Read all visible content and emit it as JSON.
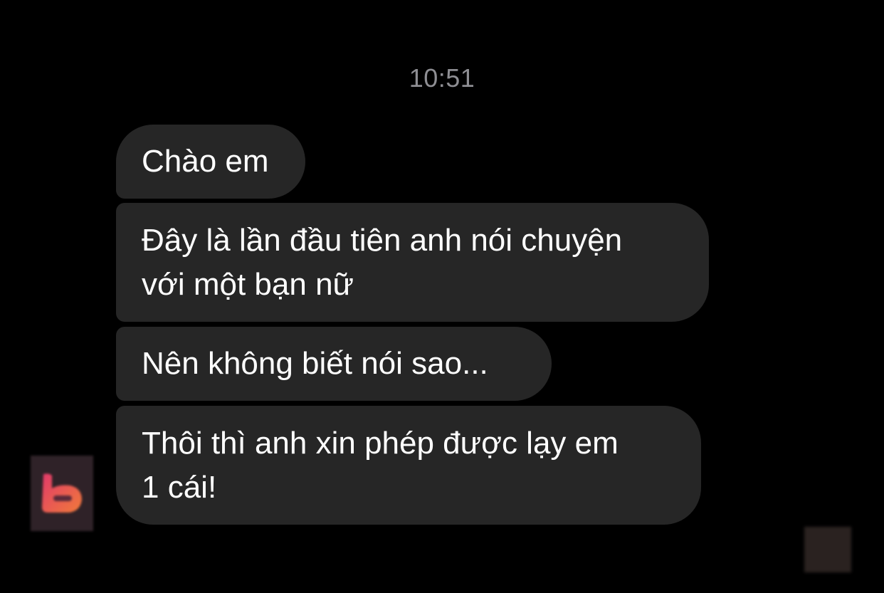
{
  "chat": {
    "timestamp": "10:51",
    "messages": [
      {
        "lines": [
          "Chào em"
        ]
      },
      {
        "lines": [
          "Đây là lần đầu tiên anh nói chuyện",
          "với một bạn nữ"
        ]
      },
      {
        "lines": [
          "Nên không biết nói sao..."
        ]
      },
      {
        "lines": [
          "Thôi thì anh xin phép được lạy em",
          "1 cái!"
        ]
      }
    ]
  },
  "icons": {
    "sender_avatar": "blurred-avatar-icon",
    "read_receipt": "blurred-read-receipt-avatar-icon"
  },
  "colors": {
    "background": "#000000",
    "bubble": "#262626",
    "text": "#ffffff",
    "timestamp": "#8e8e93"
  }
}
